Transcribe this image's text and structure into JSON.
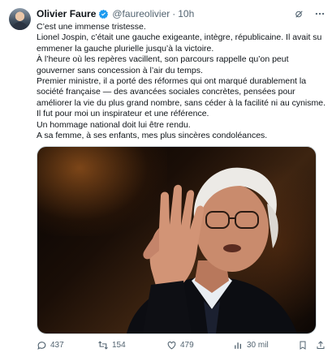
{
  "author": {
    "name": "Olivier Faure",
    "handle": "@faureolivier",
    "separator": "·",
    "time": "10h"
  },
  "icons": {
    "verified": "verified-badge-icon",
    "grok": "grok-icon",
    "more": "more-icon",
    "reply": "reply-icon",
    "retweet": "retweet-icon",
    "like": "heart-icon",
    "views": "views-icon",
    "bookmark": "bookmark-icon",
    "share": "share-icon"
  },
  "colors": {
    "verified": "#1d9bf0",
    "secondary_text": "#536471"
  },
  "text": {
    "p1": "C’est une immense tristesse.",
    "p2": "Lionel Jospin, c’était une gauche exigeante, intègre, républicaine. Il avait su emmener la gauche plurielle jusqu’à la victoire.",
    "p3": "À l’heure où les repères vacillent, son parcours rappelle qu’on peut gouverner sans concession à l’air du temps.",
    "p4": "Premier ministre, il a porté des réformes qui ont marqué durablement la société française — des avancées sociales concrètes, pensées pour améliorer la vie du plus grand nombre, sans céder à la facilité ni au cynisme. Il fut pour moi un inspirateur et une référence.",
    "p5": "Un hommage national doit lui être rendu.",
    "p6": "A sa femme, à ses enfants, mes plus sincères condoléances."
  },
  "stats": {
    "replies": "437",
    "retweets": "154",
    "likes": "479",
    "views": "30 mil"
  }
}
